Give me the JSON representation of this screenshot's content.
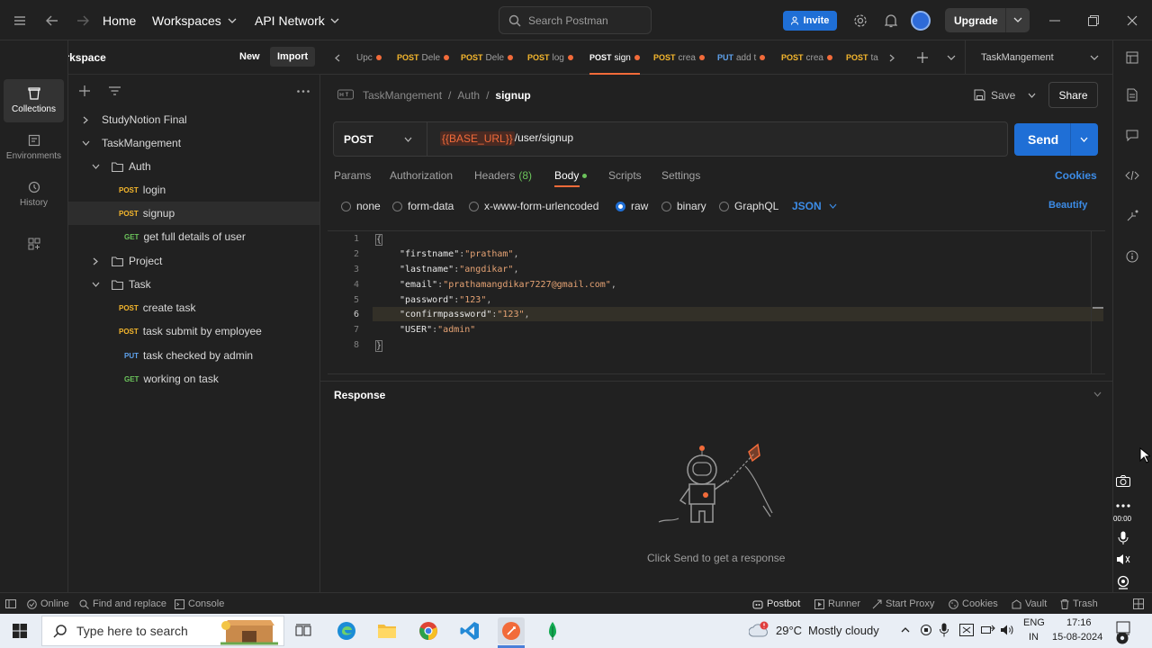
{
  "topbar": {
    "home": "Home",
    "workspaces": "Workspaces",
    "api_network": "API Network",
    "search_placeholder": "Search Postman",
    "invite": "Invite",
    "upgrade": "Upgrade"
  },
  "workspace": {
    "name": "My Workspace",
    "new": "New",
    "import": "Import"
  },
  "leftnav": [
    {
      "label": "Collections",
      "icon": "collections-icon"
    },
    {
      "label": "Environments",
      "icon": "environments-icon"
    },
    {
      "label": "History",
      "icon": "history-icon"
    },
    {
      "label": "",
      "icon": "apps-icon"
    }
  ],
  "tree": [
    {
      "label": "StudyNotion Final"
    },
    {
      "label": "TaskMangement"
    },
    {
      "label": "Auth"
    },
    {
      "method": "POST",
      "label": "login"
    },
    {
      "method": "POST",
      "label": "signup"
    },
    {
      "method": "GET",
      "label": "get full details of user"
    },
    {
      "label": "Project"
    },
    {
      "label": "Task"
    },
    {
      "method": "POST",
      "label": "create task"
    },
    {
      "method": "POST",
      "label": "task submit by employee"
    },
    {
      "method": "PUT",
      "label": "task checked by admin"
    },
    {
      "method": "GET",
      "label": "working on task"
    }
  ],
  "tabs": [
    {
      "method": "",
      "label": "Upc"
    },
    {
      "method": "POST",
      "label": "Dele"
    },
    {
      "method": "POST",
      "label": "Dele"
    },
    {
      "method": "POST",
      "label": "log"
    },
    {
      "method": "POST",
      "label": "sign"
    },
    {
      "method": "POST",
      "label": "crea"
    },
    {
      "method": "PUT",
      "label": "add t"
    },
    {
      "method": "POST",
      "label": "crea"
    },
    {
      "method": "POST",
      "label": "ta"
    }
  ],
  "environment": "TaskMangement",
  "breadcrumb": {
    "collection": "TaskMangement",
    "sep1": "/",
    "folder": "Auth",
    "sep2": "/",
    "request": "signup"
  },
  "actions": {
    "save": "Save",
    "share": "Share"
  },
  "request": {
    "method": "POST",
    "url_var": "{{BASE_URL}}",
    "url_path": "/user/signup",
    "send": "Send"
  },
  "req_tabs": {
    "params": "Params",
    "authorization": "Authorization",
    "headers": "Headers",
    "headers_count": "(8)",
    "body": "Body",
    "scripts": "Scripts",
    "settings": "Settings",
    "cookies": "Cookies"
  },
  "body_types": {
    "none": "none",
    "form_data": "form-data",
    "urlencoded": "x-www-form-urlencoded",
    "raw": "raw",
    "binary": "binary",
    "graphql": "GraphQL",
    "format": "JSON",
    "beautify": "Beautify"
  },
  "code_lines": [
    {
      "n": "1",
      "open": "{"
    },
    {
      "n": "2",
      "key": "\"firstname\"",
      "val": "\"pratham\"",
      "end": ","
    },
    {
      "n": "3",
      "key": "\"lastname\"",
      "val": "\"angdikar\"",
      "end": ","
    },
    {
      "n": "4",
      "key": "\"email\"",
      "val": "\"prathamangdikar7227@gmail.com\"",
      "end": ","
    },
    {
      "n": "5",
      "key": "\"password\"",
      "val": "\"123\"",
      "end": ","
    },
    {
      "n": "6",
      "key": "\"confirmpassword\"",
      "val": "\"123\"",
      "end": ","
    },
    {
      "n": "7",
      "key": "\"USER\"",
      "val": "\"admin\"",
      "end": ""
    },
    {
      "n": "8",
      "open": "}"
    }
  ],
  "response": {
    "title": "Response",
    "empty_text": "Click Send to get a response"
  },
  "statusbar": {
    "online": "Online",
    "find_replace": "Find and replace",
    "console": "Console",
    "postbot": "Postbot",
    "runner": "Runner",
    "start_proxy": "Start Proxy",
    "cookies": "Cookies",
    "vault": "Vault",
    "trash": "Trash"
  },
  "taskbar": {
    "search_placeholder": "Type here to search",
    "temperature": "29°C",
    "weather": "Mostly cloudy",
    "lang1": "ENG",
    "lang2": "IN",
    "time": "17:16",
    "date": "15-08-2024"
  },
  "overlay": {
    "timer": "00:00"
  },
  "colors": {
    "accent_orange": "#f26b3a",
    "brand_blue": "#1f6fd6",
    "post": "#f5b72d",
    "get": "#6bc35b",
    "put": "#5fa3ee"
  }
}
